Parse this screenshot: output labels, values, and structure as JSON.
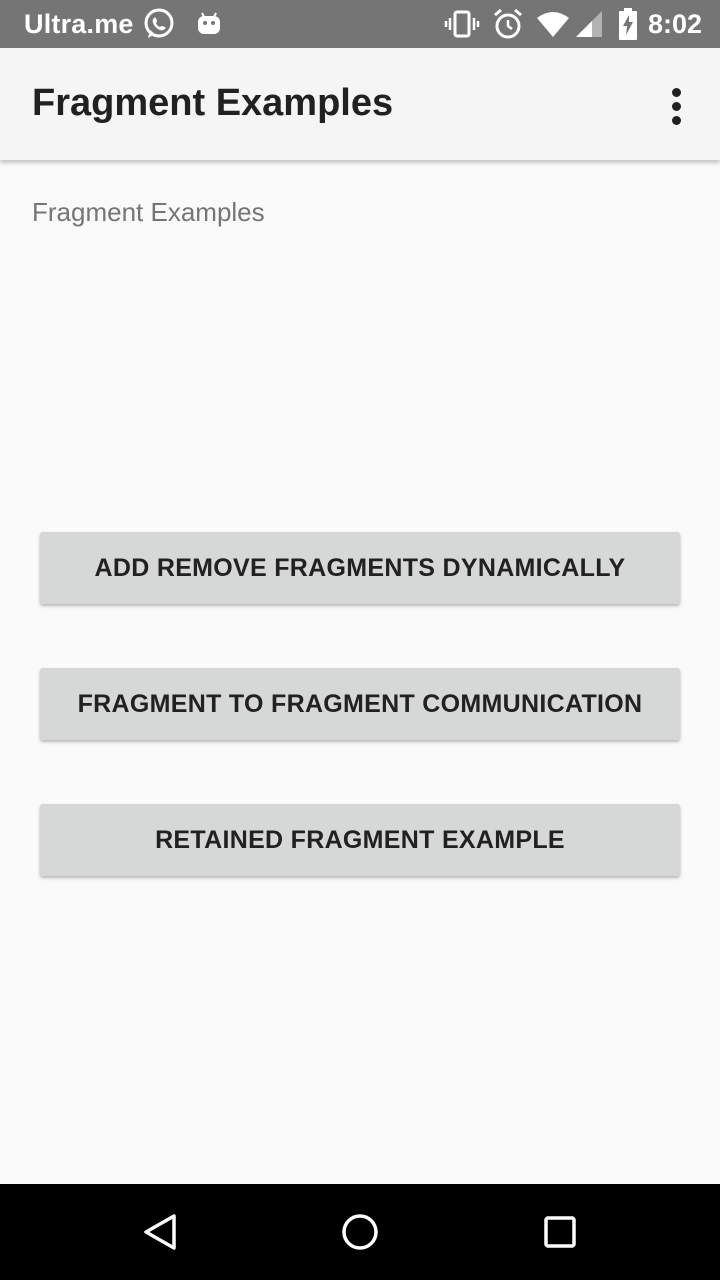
{
  "status_bar": {
    "carrier": "Ultra.me",
    "time": "8:02",
    "left_icons": [
      "whatsapp-icon",
      "android-icon"
    ],
    "right_icons": [
      "vibrate-icon",
      "alarm-icon",
      "wifi-icon",
      "signal-icon",
      "battery-charging-icon"
    ]
  },
  "app_bar": {
    "title": "Fragment Examples",
    "menu_icon": "overflow-menu-icon"
  },
  "main": {
    "subtitle": "Fragment Examples",
    "buttons": [
      {
        "label": "ADD REMOVE FRAGMENTS DYNAMICALLY"
      },
      {
        "label": "FRAGMENT TO FRAGMENT COMMUNICATION"
      },
      {
        "label": "RETAINED FRAGMENT EXAMPLE"
      }
    ]
  },
  "nav_bar": {
    "icons": [
      "back-icon",
      "home-icon",
      "recents-icon"
    ]
  },
  "colors": {
    "status_bar": "#757575",
    "app_bar": "#f5f5f5",
    "background": "#fafafa",
    "button": "#d6d7d7",
    "nav_bar": "#000000"
  }
}
